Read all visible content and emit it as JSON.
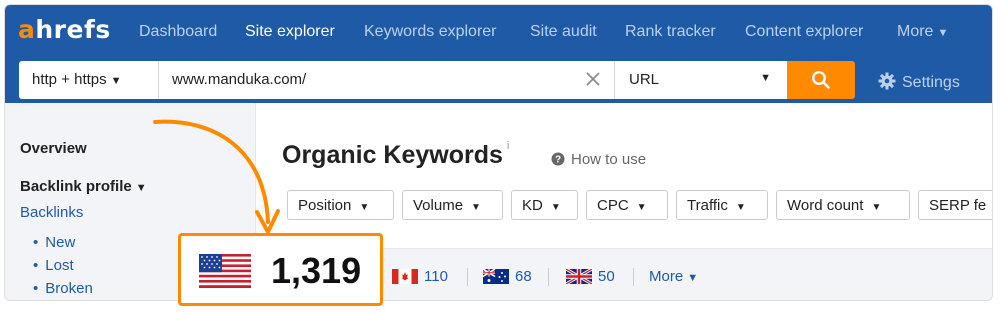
{
  "nav": {
    "logo_accent": "a",
    "logo_rest": "hrefs",
    "items": [
      {
        "label": "Dashboard"
      },
      {
        "label": "Site explorer"
      },
      {
        "label": "Keywords explorer"
      },
      {
        "label": "Site audit"
      },
      {
        "label": "Rank tracker"
      },
      {
        "label": "Content explorer"
      },
      {
        "label": "More"
      }
    ],
    "active_item": "Site explorer"
  },
  "search": {
    "protocol": "http + https",
    "url": "www.manduka.com/",
    "mode": "URL",
    "settings_label": "Settings"
  },
  "sidebar": {
    "overview": "Overview",
    "backlink_profile": "Backlink profile",
    "backlinks": "Backlinks",
    "sub_items": [
      {
        "label": "New"
      },
      {
        "label": "Lost"
      },
      {
        "label": "Broken"
      }
    ]
  },
  "main": {
    "title": "Organic Keywords",
    "info_mark": "i",
    "how_to_use": "How to use",
    "filters": [
      {
        "label": "Position"
      },
      {
        "label": "Volume"
      },
      {
        "label": "KD"
      },
      {
        "label": "CPC"
      },
      {
        "label": "Traffic"
      },
      {
        "label": "Word count"
      },
      {
        "label": "SERP fe"
      }
    ],
    "countries": [
      {
        "flag": "canada-flag-icon",
        "value": "110"
      },
      {
        "flag": "australia-flag-icon",
        "value": "68"
      },
      {
        "flag": "uk-flag-icon",
        "value": "50"
      }
    ],
    "more_label": "More"
  },
  "highlight": {
    "flag": "us-flag-icon",
    "value": "1,319"
  },
  "colors": {
    "nav_bg": "#1f5aa6",
    "accent": "#ff8a00",
    "link": "#1f5aa6",
    "sidebar_bg": "#f2f4f7"
  }
}
